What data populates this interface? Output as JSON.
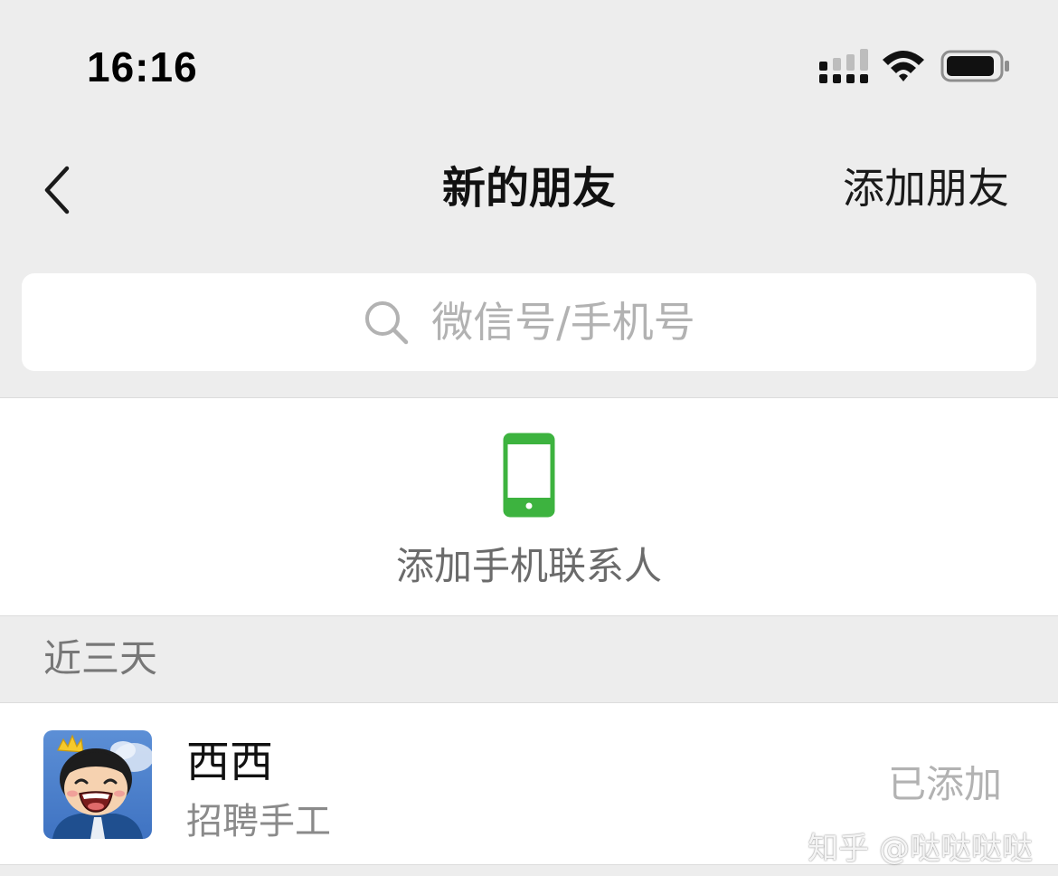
{
  "status_bar": {
    "time": "16:16",
    "icons": [
      "signal-icon",
      "wifi-icon",
      "battery-icon"
    ]
  },
  "nav": {
    "back_icon": "chevron-left-icon",
    "title": "新的朋友",
    "action_label": "添加朋友"
  },
  "search": {
    "icon": "search-icon",
    "placeholder": "微信号/手机号"
  },
  "phone_contacts": {
    "icon": "phone-icon",
    "label": "添加手机联系人"
  },
  "recent_section": {
    "title": "近三天",
    "items": [
      {
        "name": "西西",
        "message": "招聘手工",
        "status": "已添加",
        "avatar": "cartoon-avatar"
      }
    ]
  },
  "watermark": "知乎 @哒哒哒哒",
  "colors": {
    "background": "#ededed",
    "card": "#ffffff",
    "accent_green": "#3db33f",
    "muted_text": "#b2b2b2"
  }
}
